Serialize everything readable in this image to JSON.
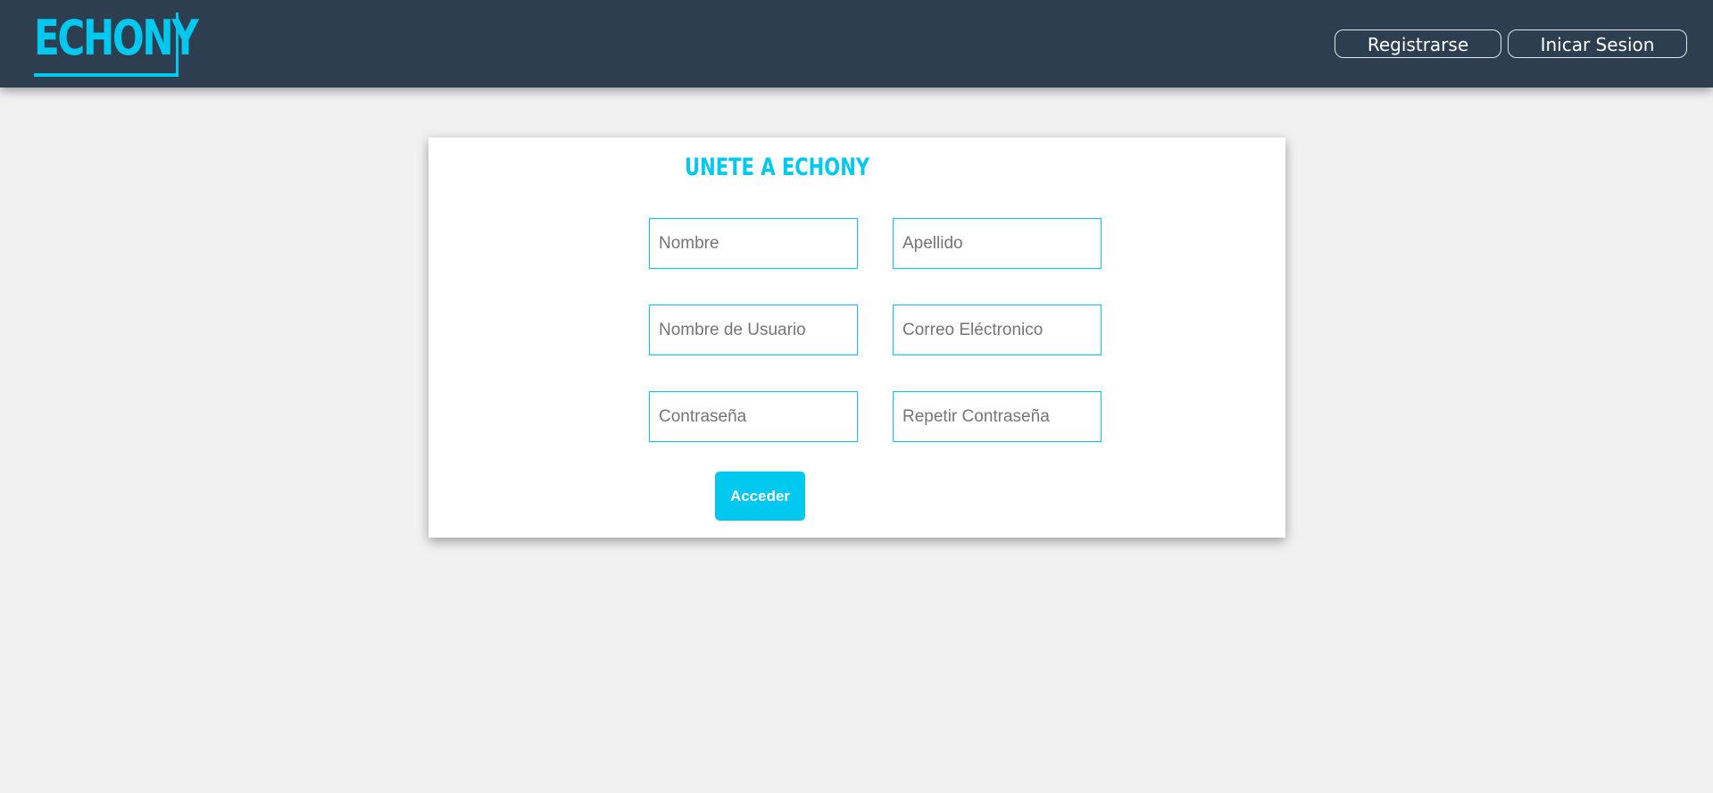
{
  "header": {
    "logo_text": "ECHONY",
    "nav": {
      "register_label": "Registrarse",
      "login_label": "Inicar Sesion"
    }
  },
  "form": {
    "title": "UNETE A ECHONY",
    "fields": {
      "first_name": {
        "placeholder": "Nombre",
        "value": ""
      },
      "last_name": {
        "placeholder": "Apellido",
        "value": ""
      },
      "username": {
        "placeholder": "Nombre de Usuario",
        "value": ""
      },
      "email": {
        "placeholder": "Correo Eléctronico",
        "value": ""
      },
      "password": {
        "placeholder": "Contraseña",
        "value": ""
      },
      "password_repeat": {
        "placeholder": "Repetir Contraseña",
        "value": ""
      }
    },
    "submit_label": "Acceder"
  },
  "colors": {
    "header_bg": "#2c3e50",
    "accent": "#00c8ee",
    "page_bg": "#f1f1f1",
    "card_bg": "#ffffff"
  }
}
